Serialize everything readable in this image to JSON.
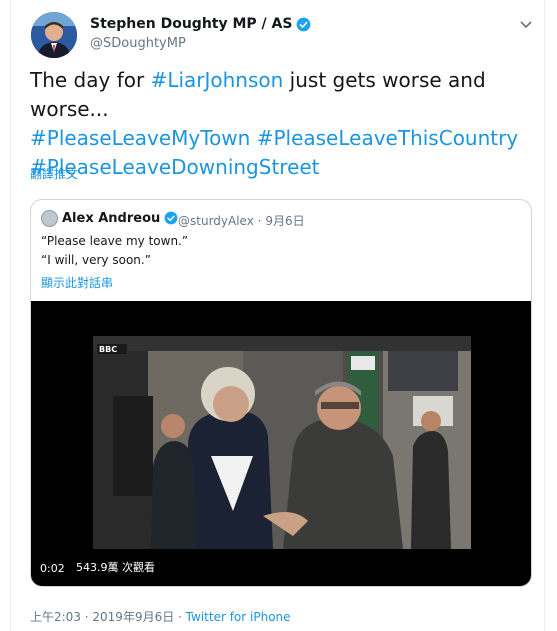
{
  "author": {
    "name": "Stephen Doughty MP / AS",
    "handle": "@SDoughtyMP",
    "avatar": "avatar"
  },
  "tweet": {
    "text_plain": "The day for ",
    "hashtag1": "#LiarJohnson",
    "text_mid": " just gets worse and worse...",
    "hashtag2": "#PleaseLeaveMyTown",
    "hashtag3": "#PleaseLeaveThisCountry",
    "hashtag4": "#PleaseLeaveDowningStreet",
    "translate_label": "翻譯推文"
  },
  "quoted": {
    "name": "Alex Andreou",
    "handle": "@sturdyAlex",
    "separator": "·",
    "date": "9月6日",
    "line1": "“Please leave my town.”",
    "line2": "“I will, very soon.”",
    "thread_label": "顯示此對話串",
    "video": {
      "time": "0:02",
      "views": "543.9萬 次觀看",
      "overlay_logo": "BBC"
    }
  },
  "footer": {
    "time": "上午2:03",
    "sep1": " · ",
    "date": "2019年9月6日",
    "sep2": " · ",
    "source": "Twitter for iPhone"
  },
  "colors": {
    "accent": "#1b95e0",
    "muted": "#657786",
    "border": "#ccd6dd"
  },
  "icons": [
    "verified-icon",
    "chevron-down-icon"
  ]
}
